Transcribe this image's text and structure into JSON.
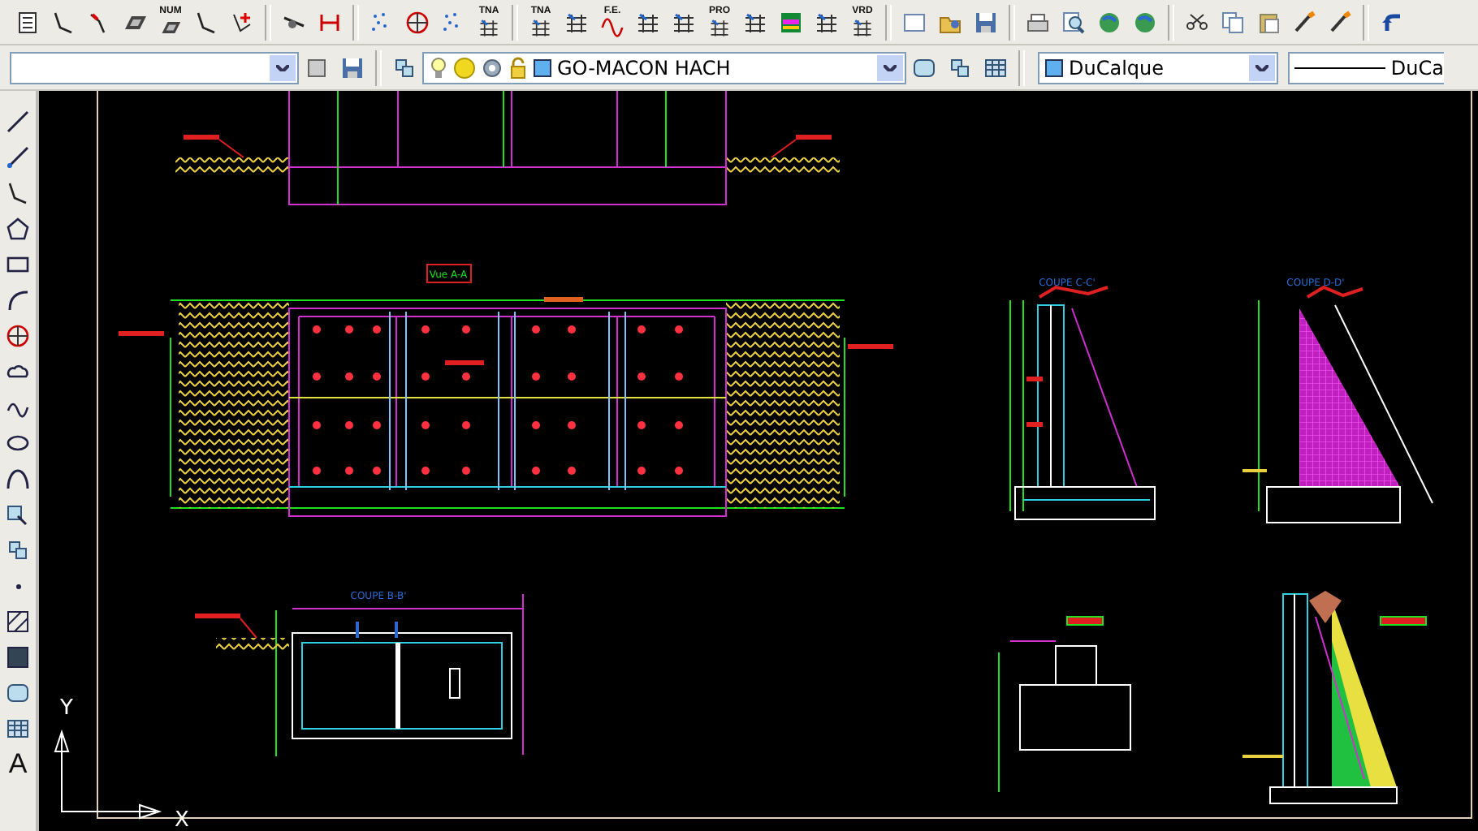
{
  "standard_toolbar": [
    {
      "kind": "list"
    },
    {
      "kind": "polyline"
    },
    {
      "kind": "arrow"
    },
    {
      "kind": "slab"
    },
    {
      "kind": "slab",
      "label": "NUM"
    },
    {
      "kind": "polyline"
    },
    {
      "kind": "cross"
    },
    {
      "kind": "sep"
    },
    {
      "kind": "pointline"
    },
    {
      "kind": "dimension"
    },
    {
      "kind": "sep"
    },
    {
      "kind": "dots"
    },
    {
      "kind": "circle"
    },
    {
      "kind": "dots"
    },
    {
      "kind": "grid",
      "label": "TNA"
    },
    {
      "kind": "sep"
    },
    {
      "kind": "grid",
      "label": "TNA"
    },
    {
      "kind": "grid"
    },
    {
      "kind": "wave",
      "label": "F.E."
    },
    {
      "kind": "grid"
    },
    {
      "kind": "grid"
    },
    {
      "kind": "grid",
      "label": "PRO"
    },
    {
      "kind": "grid"
    },
    {
      "kind": "chart"
    },
    {
      "kind": "grid"
    },
    {
      "kind": "grid",
      "label": "VRD"
    },
    {
      "kind": "sep"
    },
    {
      "kind": "page"
    },
    {
      "kind": "folder"
    },
    {
      "kind": "disk"
    },
    {
      "kind": "sep"
    },
    {
      "kind": "printer"
    },
    {
      "kind": "magnifier"
    },
    {
      "kind": "globe"
    },
    {
      "kind": "globe"
    },
    {
      "kind": "sep"
    },
    {
      "kind": "scissors"
    },
    {
      "kind": "copy"
    },
    {
      "kind": "paste"
    },
    {
      "kind": "brush"
    },
    {
      "kind": "brush"
    },
    {
      "kind": "sep"
    },
    {
      "kind": "undo"
    }
  ],
  "properties_bar": {
    "layer_combo": {
      "name": "GO-MACON HACH"
    },
    "color_combo": {
      "value": "DuCalque"
    },
    "linetype_combo": {
      "value": "DuCa"
    }
  },
  "draw_toolbar": [
    {
      "kind": "line"
    },
    {
      "kind": "ray"
    },
    {
      "kind": "polyline"
    },
    {
      "kind": "polygon"
    },
    {
      "kind": "rectangle"
    },
    {
      "kind": "arc"
    },
    {
      "kind": "circle"
    },
    {
      "kind": "cloud"
    },
    {
      "kind": "spline"
    },
    {
      "kind": "ellipse"
    },
    {
      "kind": "ellipse-arc"
    },
    {
      "kind": "insert"
    },
    {
      "kind": "block"
    },
    {
      "kind": "point"
    },
    {
      "kind": "hatch"
    },
    {
      "kind": "gradient"
    },
    {
      "kind": "region"
    },
    {
      "kind": "table"
    },
    {
      "kind": "text",
      "label": "A"
    }
  ],
  "drawing": {
    "titles": [
      "Vue A-A",
      "COUPE C-C'",
      "COUPE D-D'",
      "COUPE B-B'"
    ],
    "ucs": {
      "x_label": "X",
      "y_label": "Y"
    }
  }
}
